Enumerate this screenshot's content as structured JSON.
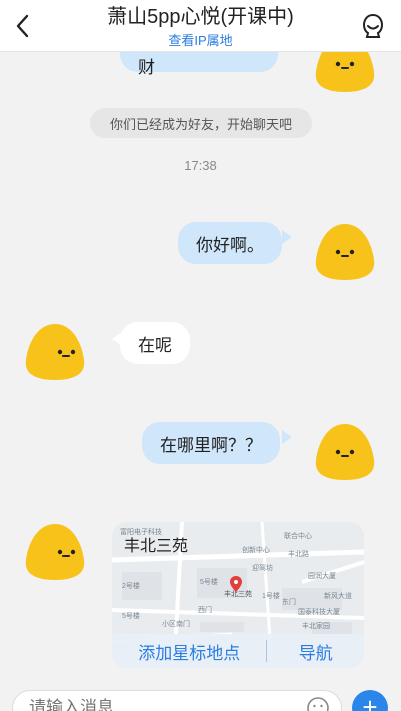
{
  "header": {
    "back_icon": "chevron-left-icon",
    "title": "萧山5pp心悦(开课中)",
    "subtitle": "查看IP属地",
    "profile_icon": "user-profile-icon"
  },
  "messages": {
    "top_partial": "我是 点哇哇发财",
    "system_notice": "你们已经成为好友，开始聊天吧",
    "timestamp": "17:38",
    "outgoing_1": "你好啊。",
    "incoming_1": "在呢",
    "outgoing_2": "在哪里啊？？"
  },
  "location_card": {
    "place_name": "丰北三苑",
    "add_star_label": "添加星标地点",
    "navigate_label": "导航",
    "map_labels": [
      "丰北三苑",
      "富阳电子科技",
      "联合中心",
      "迎驾坊",
      "园润大厦",
      "5号楼",
      "2号楼",
      "1号楼",
      "西门",
      "5号楼",
      "小区南门",
      "东门",
      "国泰科技大厦",
      "丰北家园",
      "新风大道",
      "创新中心",
      "丰北路"
    ]
  },
  "composer": {
    "placeholder": "请输入消息",
    "emoji_icon": "emoji-smile-icon",
    "plus_icon": "plus-icon"
  },
  "colors": {
    "accent": "#2a7de1",
    "outgoing_bubble": "#cfe6fb",
    "incoming_bubble": "#ffffff",
    "background": "#f2f2f2",
    "avatar_yellow": "#f7c21a"
  }
}
